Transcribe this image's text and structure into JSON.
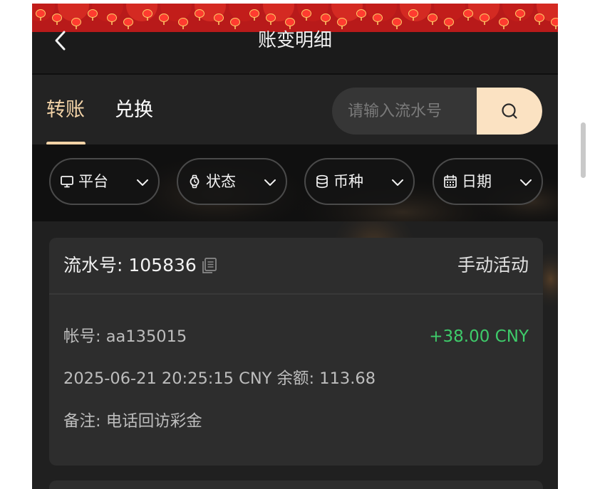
{
  "header": {
    "title": "账变明细"
  },
  "tabs": [
    {
      "label": "转账",
      "active": true
    },
    {
      "label": "兑换",
      "active": false
    }
  ],
  "search": {
    "placeholder": "请输入流水号",
    "value": ""
  },
  "filters": [
    {
      "label": "平台",
      "icon": "monitor-icon"
    },
    {
      "label": "状态",
      "icon": "watch-icon"
    },
    {
      "label": "币种",
      "icon": "coins-icon"
    },
    {
      "label": "日期",
      "icon": "calendar-icon"
    }
  ],
  "record": {
    "serial_label": "流水号: 105836",
    "type": "手动活动",
    "account": "帐号: aa135015",
    "amount": "+38.00 CNY",
    "time_balance": "2025-06-21 20:25:15 CNY 余额: 113.68",
    "remark": "备注: 电话回访彩金"
  },
  "colors": {
    "accent": "#f3d3a7",
    "search_button": "#fbe2c2",
    "positive_amount": "#3ecb6a",
    "background": "#1b1b1b",
    "card": "#2d2d2d"
  }
}
